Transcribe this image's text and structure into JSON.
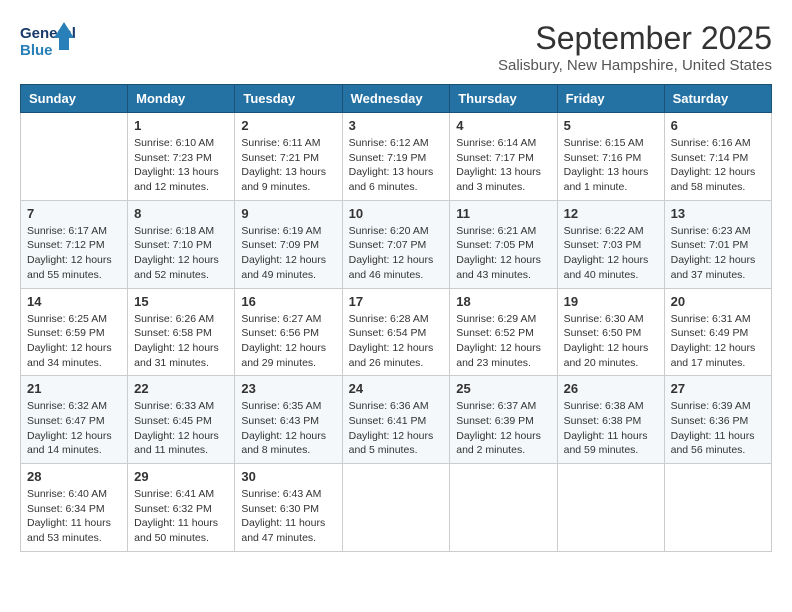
{
  "header": {
    "logo_line1": "General",
    "logo_line2": "Blue",
    "month_title": "September 2025",
    "subtitle": "Salisbury, New Hampshire, United States"
  },
  "weekdays": [
    "Sunday",
    "Monday",
    "Tuesday",
    "Wednesday",
    "Thursday",
    "Friday",
    "Saturday"
  ],
  "weeks": [
    [
      {
        "day": "",
        "sunrise": "",
        "sunset": "",
        "daylight": ""
      },
      {
        "day": "1",
        "sunrise": "Sunrise: 6:10 AM",
        "sunset": "Sunset: 7:23 PM",
        "daylight": "Daylight: 13 hours and 12 minutes."
      },
      {
        "day": "2",
        "sunrise": "Sunrise: 6:11 AM",
        "sunset": "Sunset: 7:21 PM",
        "daylight": "Daylight: 13 hours and 9 minutes."
      },
      {
        "day": "3",
        "sunrise": "Sunrise: 6:12 AM",
        "sunset": "Sunset: 7:19 PM",
        "daylight": "Daylight: 13 hours and 6 minutes."
      },
      {
        "day": "4",
        "sunrise": "Sunrise: 6:14 AM",
        "sunset": "Sunset: 7:17 PM",
        "daylight": "Daylight: 13 hours and 3 minutes."
      },
      {
        "day": "5",
        "sunrise": "Sunrise: 6:15 AM",
        "sunset": "Sunset: 7:16 PM",
        "daylight": "Daylight: 13 hours and 1 minute."
      },
      {
        "day": "6",
        "sunrise": "Sunrise: 6:16 AM",
        "sunset": "Sunset: 7:14 PM",
        "daylight": "Daylight: 12 hours and 58 minutes."
      }
    ],
    [
      {
        "day": "7",
        "sunrise": "Sunrise: 6:17 AM",
        "sunset": "Sunset: 7:12 PM",
        "daylight": "Daylight: 12 hours and 55 minutes."
      },
      {
        "day": "8",
        "sunrise": "Sunrise: 6:18 AM",
        "sunset": "Sunset: 7:10 PM",
        "daylight": "Daylight: 12 hours and 52 minutes."
      },
      {
        "day": "9",
        "sunrise": "Sunrise: 6:19 AM",
        "sunset": "Sunset: 7:09 PM",
        "daylight": "Daylight: 12 hours and 49 minutes."
      },
      {
        "day": "10",
        "sunrise": "Sunrise: 6:20 AM",
        "sunset": "Sunset: 7:07 PM",
        "daylight": "Daylight: 12 hours and 46 minutes."
      },
      {
        "day": "11",
        "sunrise": "Sunrise: 6:21 AM",
        "sunset": "Sunset: 7:05 PM",
        "daylight": "Daylight: 12 hours and 43 minutes."
      },
      {
        "day": "12",
        "sunrise": "Sunrise: 6:22 AM",
        "sunset": "Sunset: 7:03 PM",
        "daylight": "Daylight: 12 hours and 40 minutes."
      },
      {
        "day": "13",
        "sunrise": "Sunrise: 6:23 AM",
        "sunset": "Sunset: 7:01 PM",
        "daylight": "Daylight: 12 hours and 37 minutes."
      }
    ],
    [
      {
        "day": "14",
        "sunrise": "Sunrise: 6:25 AM",
        "sunset": "Sunset: 6:59 PM",
        "daylight": "Daylight: 12 hours and 34 minutes."
      },
      {
        "day": "15",
        "sunrise": "Sunrise: 6:26 AM",
        "sunset": "Sunset: 6:58 PM",
        "daylight": "Daylight: 12 hours and 31 minutes."
      },
      {
        "day": "16",
        "sunrise": "Sunrise: 6:27 AM",
        "sunset": "Sunset: 6:56 PM",
        "daylight": "Daylight: 12 hours and 29 minutes."
      },
      {
        "day": "17",
        "sunrise": "Sunrise: 6:28 AM",
        "sunset": "Sunset: 6:54 PM",
        "daylight": "Daylight: 12 hours and 26 minutes."
      },
      {
        "day": "18",
        "sunrise": "Sunrise: 6:29 AM",
        "sunset": "Sunset: 6:52 PM",
        "daylight": "Daylight: 12 hours and 23 minutes."
      },
      {
        "day": "19",
        "sunrise": "Sunrise: 6:30 AM",
        "sunset": "Sunset: 6:50 PM",
        "daylight": "Daylight: 12 hours and 20 minutes."
      },
      {
        "day": "20",
        "sunrise": "Sunrise: 6:31 AM",
        "sunset": "Sunset: 6:49 PM",
        "daylight": "Daylight: 12 hours and 17 minutes."
      }
    ],
    [
      {
        "day": "21",
        "sunrise": "Sunrise: 6:32 AM",
        "sunset": "Sunset: 6:47 PM",
        "daylight": "Daylight: 12 hours and 14 minutes."
      },
      {
        "day": "22",
        "sunrise": "Sunrise: 6:33 AM",
        "sunset": "Sunset: 6:45 PM",
        "daylight": "Daylight: 12 hours and 11 minutes."
      },
      {
        "day": "23",
        "sunrise": "Sunrise: 6:35 AM",
        "sunset": "Sunset: 6:43 PM",
        "daylight": "Daylight: 12 hours and 8 minutes."
      },
      {
        "day": "24",
        "sunrise": "Sunrise: 6:36 AM",
        "sunset": "Sunset: 6:41 PM",
        "daylight": "Daylight: 12 hours and 5 minutes."
      },
      {
        "day": "25",
        "sunrise": "Sunrise: 6:37 AM",
        "sunset": "Sunset: 6:39 PM",
        "daylight": "Daylight: 12 hours and 2 minutes."
      },
      {
        "day": "26",
        "sunrise": "Sunrise: 6:38 AM",
        "sunset": "Sunset: 6:38 PM",
        "daylight": "Daylight: 11 hours and 59 minutes."
      },
      {
        "day": "27",
        "sunrise": "Sunrise: 6:39 AM",
        "sunset": "Sunset: 6:36 PM",
        "daylight": "Daylight: 11 hours and 56 minutes."
      }
    ],
    [
      {
        "day": "28",
        "sunrise": "Sunrise: 6:40 AM",
        "sunset": "Sunset: 6:34 PM",
        "daylight": "Daylight: 11 hours and 53 minutes."
      },
      {
        "day": "29",
        "sunrise": "Sunrise: 6:41 AM",
        "sunset": "Sunset: 6:32 PM",
        "daylight": "Daylight: 11 hours and 50 minutes."
      },
      {
        "day": "30",
        "sunrise": "Sunrise: 6:43 AM",
        "sunset": "Sunset: 6:30 PM",
        "daylight": "Daylight: 11 hours and 47 minutes."
      },
      {
        "day": "",
        "sunrise": "",
        "sunset": "",
        "daylight": ""
      },
      {
        "day": "",
        "sunrise": "",
        "sunset": "",
        "daylight": ""
      },
      {
        "day": "",
        "sunrise": "",
        "sunset": "",
        "daylight": ""
      },
      {
        "day": "",
        "sunrise": "",
        "sunset": "",
        "daylight": ""
      }
    ]
  ]
}
